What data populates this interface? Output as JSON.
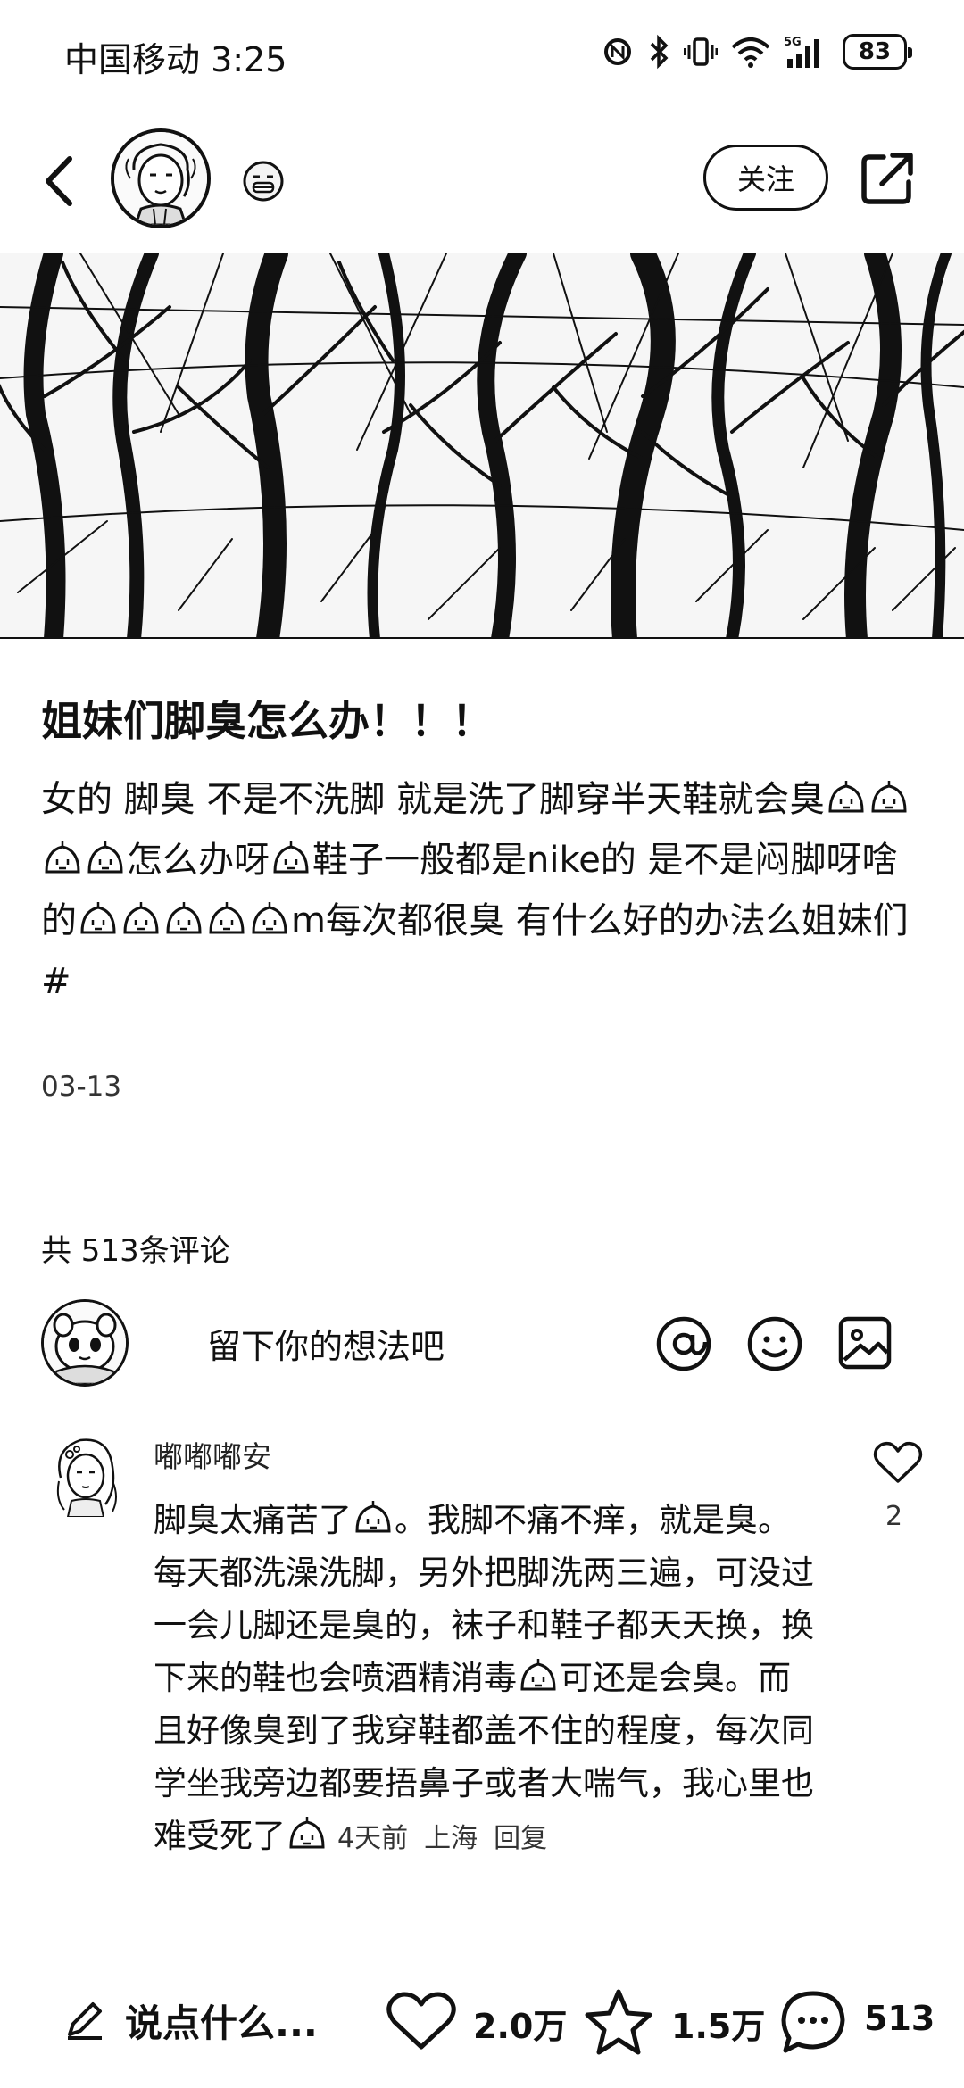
{
  "status_bar": {
    "carrier_time": "中国移动 3:25",
    "network": "5G",
    "battery": "83"
  },
  "header": {
    "follow_label": "关注"
  },
  "post": {
    "title": "姐妹们脚臭怎么办！！！",
    "body_parts": [
      "女的 脚臭 不是不洗脚 就是洗了脚穿半天鞋就会臭",
      "怎么办呀",
      "鞋子一般都是nike的 是不是闷脚呀啥的",
      "m每次都很臭 有什么好的办法么姐妹们#"
    ],
    "date": "03-13"
  },
  "comments_section": {
    "count_label": "共 513条评论",
    "input_placeholder": "留下你的想法吧"
  },
  "comment": {
    "author": "嘟嘟嘟安",
    "text_parts": [
      "脚臭太痛苦了",
      "。我脚不痛不痒，就是臭。每天都洗澡洗脚，另外把脚洗两三遍，可没过一会儿脚还是臭的，袜子和鞋子都天天换，换下来的鞋也会喷酒精消毒",
      "可还是会臭。而且好像臭到了我穿鞋都盖不住的程度，每次同学坐我旁边都要捂鼻子或者大喘气，我心里也难受死了"
    ],
    "time": "4天前",
    "location": "上海",
    "reply_label": "回复",
    "likes": "2"
  },
  "bottom_bar": {
    "input_label": "说点什么...",
    "likes": "2.0万",
    "favorites": "1.5万",
    "comments": "513"
  },
  "icons": {
    "back": "back-arrow",
    "share": "share-external",
    "at": "at-sign",
    "emoji": "smiley-face",
    "image": "image-picture",
    "like": "heart-outline",
    "favorite": "star-outline",
    "comment": "speech-bubble",
    "pencil": "pencil"
  }
}
